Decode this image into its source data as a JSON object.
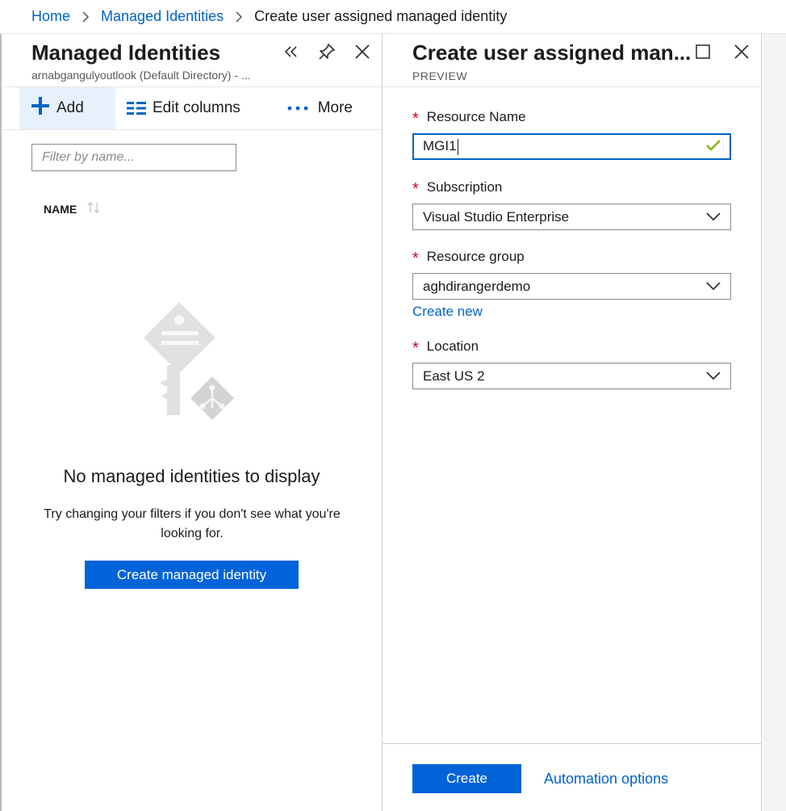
{
  "breadcrumb": {
    "home": "Home",
    "managed_identities": "Managed Identities",
    "current": "Create user assigned managed identity"
  },
  "left_blade": {
    "title": "Managed Identities",
    "subtitle": "arnabgangulyoutlook (Default Directory) - ...",
    "header_icons": [
      "collapse-icon",
      "pin-icon",
      "close-icon"
    ],
    "toolbar": {
      "add": "Add",
      "edit_columns": "Edit columns",
      "more": "More"
    },
    "filter_placeholder": "Filter by name...",
    "column_name": "NAME",
    "empty_title": "No managed identities to display",
    "empty_desc": "Try changing your filters if you don't see what you're looking for.",
    "create_button": "Create managed identity"
  },
  "right_blade": {
    "title": "Create user assigned man...",
    "badge": "PREVIEW",
    "header_icons": [
      "maximize-icon",
      "close-icon"
    ],
    "required_marker": "*",
    "fields": {
      "resource_name": {
        "label": "Resource Name",
        "value": "MGI1"
      },
      "subscription": {
        "label": "Subscription",
        "value": "Visual Studio Enterprise"
      },
      "resource_group": {
        "label": "Resource group",
        "value": "aghdirangerdemo",
        "create_new": "Create new"
      },
      "location": {
        "label": "Location",
        "value": "East US 2"
      }
    },
    "footer": {
      "create": "Create",
      "automation": "Automation options"
    }
  },
  "colors": {
    "accent": "#0063c6",
    "primary_button": "#0063d8",
    "required": "#d0021b",
    "valid_check": "#7fba00"
  }
}
